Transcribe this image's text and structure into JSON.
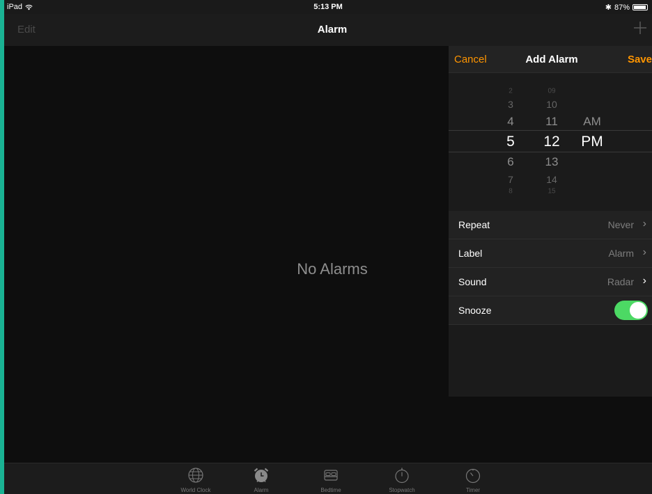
{
  "status_bar": {
    "device": "iPad",
    "time": "5:13 PM",
    "bluetooth": "✱",
    "battery": "87%"
  },
  "nav": {
    "edit": "Edit",
    "title": "Alarm"
  },
  "main": {
    "empty_message": "No Alarms"
  },
  "add_alarm": {
    "cancel": "Cancel",
    "title": "Add Alarm",
    "save": "Save",
    "picker": {
      "hours": [
        "2",
        "3",
        "4",
        "5",
        "6",
        "7",
        "8"
      ],
      "minutes": [
        "09",
        "10",
        "11",
        "12",
        "13",
        "14",
        "15"
      ],
      "periods": [
        "AM",
        "PM"
      ],
      "selected_hour": "5",
      "selected_minute": "12",
      "selected_period": "PM"
    },
    "rows": [
      {
        "label": "Repeat",
        "value": "Never"
      },
      {
        "label": "Label",
        "value": "Alarm"
      },
      {
        "label": "Sound",
        "value": "Radar"
      },
      {
        "label": "Snooze",
        "toggle_on": true
      }
    ]
  },
  "tabs": [
    {
      "label": "World Clock",
      "icon": "globe-icon"
    },
    {
      "label": "Alarm",
      "icon": "alarm-clock-icon",
      "active": true
    },
    {
      "label": "Bedtime",
      "icon": "bed-icon"
    },
    {
      "label": "Stopwatch",
      "icon": "stopwatch-icon"
    },
    {
      "label": "Timer",
      "icon": "timer-icon"
    }
  ],
  "colors": {
    "accent": "#ff9500",
    "toggle_on": "#4cd964",
    "frame": "#1ab394"
  }
}
